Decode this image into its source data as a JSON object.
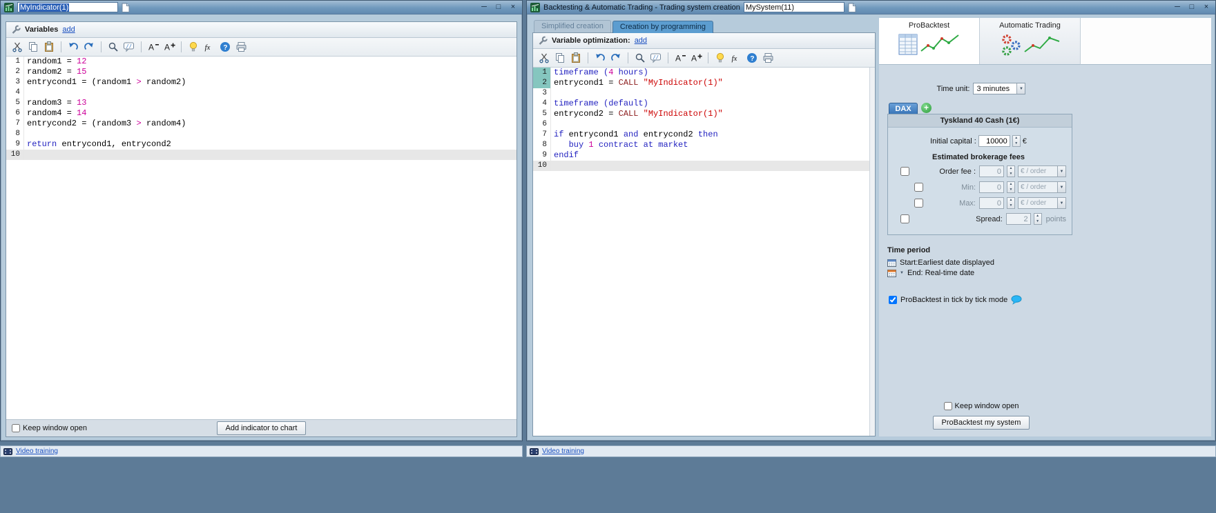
{
  "window_controls": {
    "minimize": "─",
    "maximize": "□",
    "close": "×"
  },
  "left_window": {
    "title": "MyIndicator(1)",
    "panel": {
      "title": "Variables",
      "add": "add"
    },
    "toolbar_icons": [
      "cut",
      "copy",
      "paste",
      "undo",
      "redo",
      "search",
      "comment",
      "font-smaller",
      "font-larger",
      "hint",
      "insert-function",
      "help",
      "print"
    ],
    "code": [
      {
        "n": "1",
        "seg": [
          {
            "t": "random1 = ",
            "c": "d"
          },
          {
            "t": "12",
            "c": "n"
          }
        ]
      },
      {
        "n": "2",
        "seg": [
          {
            "t": "random2 = ",
            "c": "d"
          },
          {
            "t": "15",
            "c": "n"
          }
        ]
      },
      {
        "n": "3",
        "seg": [
          {
            "t": "entrycond1 = (random1 ",
            "c": "d"
          },
          {
            "t": ">",
            "c": "n"
          },
          {
            "t": " random2)",
            "c": "d"
          }
        ]
      },
      {
        "n": "4",
        "seg": []
      },
      {
        "n": "5",
        "seg": [
          {
            "t": "random3 = ",
            "c": "d"
          },
          {
            "t": "13",
            "c": "n"
          }
        ]
      },
      {
        "n": "6",
        "seg": [
          {
            "t": "random4 = ",
            "c": "d"
          },
          {
            "t": "14",
            "c": "n"
          }
        ]
      },
      {
        "n": "7",
        "seg": [
          {
            "t": "entrycond2 = (random3 ",
            "c": "d"
          },
          {
            "t": ">",
            "c": "n"
          },
          {
            "t": " random4)",
            "c": "d"
          }
        ]
      },
      {
        "n": "8",
        "seg": []
      },
      {
        "n": "9",
        "seg": [
          {
            "t": "return",
            "c": "k"
          },
          {
            "t": " entrycond1, entrycond2",
            "c": "d"
          }
        ]
      },
      {
        "n": "10",
        "seg": [],
        "cur": true
      }
    ],
    "footer": {
      "keep_open": "Keep window open",
      "add_button": "Add indicator to chart"
    },
    "status_link": "Video training"
  },
  "right_window": {
    "title": "Backtesting & Automatic Trading - Trading system creation",
    "name_field": "MySystem(11)",
    "tabs": {
      "simplified": "Simplified creation",
      "programming": "Creation by programming"
    },
    "panel": {
      "title": "Variable optimization:",
      "add": "add"
    },
    "toolbar_icons": [
      "cut",
      "copy",
      "paste",
      "undo",
      "redo",
      "search",
      "comment",
      "font-smaller",
      "font-larger",
      "hint",
      "insert-function",
      "help",
      "print"
    ],
    "code": [
      {
        "n": "1",
        "g": true,
        "seg": [
          {
            "t": "timeframe (",
            "c": "k"
          },
          {
            "t": "4",
            "c": "n"
          },
          {
            "t": " hours)",
            "c": "k"
          }
        ]
      },
      {
        "n": "2",
        "g": true,
        "seg": [
          {
            "t": "entrycond1 = ",
            "c": "d"
          },
          {
            "t": "CALL ",
            "c": "c"
          },
          {
            "t": "\"MyIndicator(1)\"",
            "c": "s"
          }
        ]
      },
      {
        "n": "3",
        "seg": []
      },
      {
        "n": "4",
        "seg": [
          {
            "t": "timeframe (default)",
            "c": "k"
          }
        ]
      },
      {
        "n": "5",
        "seg": [
          {
            "t": "entrycond2 = ",
            "c": "d"
          },
          {
            "t": "CALL ",
            "c": "c"
          },
          {
            "t": "\"MyIndicator(1)\"",
            "c": "s"
          }
        ]
      },
      {
        "n": "6",
        "seg": []
      },
      {
        "n": "7",
        "seg": [
          {
            "t": "if",
            "c": "k"
          },
          {
            "t": " entrycond1 ",
            "c": "d"
          },
          {
            "t": "and",
            "c": "k"
          },
          {
            "t": " entrycond2 ",
            "c": "d"
          },
          {
            "t": "then",
            "c": "k"
          }
        ]
      },
      {
        "n": "8",
        "seg": [
          {
            "t": "   buy ",
            "c": "k"
          },
          {
            "t": "1",
            "c": "n"
          },
          {
            "t": " contract at market",
            "c": "k"
          }
        ]
      },
      {
        "n": "9",
        "seg": [
          {
            "t": "endif",
            "c": "k"
          }
        ]
      },
      {
        "n": "10",
        "seg": [],
        "cur": true
      }
    ],
    "sidebar": {
      "tab_probacktest": "ProBacktest",
      "tab_automatic": "Automatic Trading",
      "time_unit_label": "Time unit:",
      "time_unit_value": "3 minutes",
      "market_tab": "DAX",
      "instrument_title": "Tyskland 40 Cash (1€)",
      "initial_capital_label": "Initial capital :",
      "initial_capital_value": "10000",
      "initial_capital_unit": "€",
      "fees_title": "Estimated brokerage fees",
      "fees": [
        {
          "label": "Order fee :",
          "value": "0",
          "unit": "€ / order",
          "checked": false
        },
        {
          "label": "Min:",
          "value": "0",
          "unit": "€ / order",
          "checked": false
        },
        {
          "label": "Max:",
          "value": "0",
          "unit": "€ / order",
          "checked": false
        },
        {
          "label": "Spread:",
          "value": "2",
          "unit": "points",
          "checked": false
        }
      ],
      "time_period_title": "Time period",
      "start_label": "Start:",
      "start_value": "Earliest date displayed",
      "end_label": "End:",
      "end_value": "Real-time date",
      "tick_mode_label": "ProBacktest in tick by tick mode",
      "tick_mode_checked": true,
      "keep_open": "Keep window open",
      "run_button": "ProBacktest my system"
    },
    "status_link": "Video training"
  }
}
